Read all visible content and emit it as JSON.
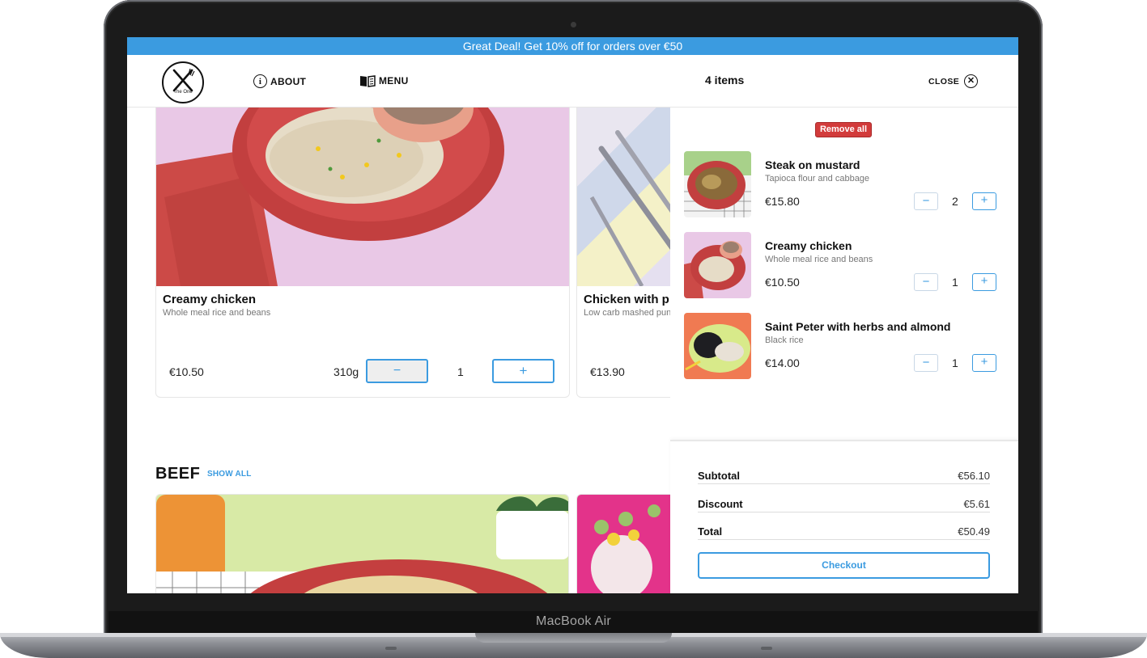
{
  "device": {
    "model_label": "MacBook Air"
  },
  "promo": {
    "text": "Great Deal! Get 10% off for orders over €50"
  },
  "nav": {
    "logo_text": "The One",
    "about_label": "ABOUT",
    "about_icon": "info-icon",
    "menu_label": "MENU",
    "menu_icon": "book-icon",
    "cart_count": "4 items",
    "close_label": "CLOSE",
    "close_icon": "close-circle-icon"
  },
  "main": {
    "cards": [
      {
        "name": "Creamy chicken",
        "desc": "Whole meal rice and beans",
        "price": "€10.50",
        "weight": "310g",
        "qty": "1",
        "minus": "−",
        "plus": "+"
      },
      {
        "name": "Chicken with p",
        "desc": "Low carb mashed pun",
        "price": "€13.90"
      }
    ],
    "section": {
      "title": "BEEF",
      "show_all": "SHOW ALL"
    }
  },
  "cart": {
    "remove_all": "Remove all",
    "items": [
      {
        "name": "Steak on mustard",
        "desc": "Tapioca flour and cabbage",
        "price": "€15.80",
        "qty": "2",
        "minus": "−",
        "plus": "+"
      },
      {
        "name": "Creamy chicken",
        "desc": "Whole meal rice and beans",
        "price": "€10.50",
        "qty": "1",
        "minus": "−",
        "plus": "+"
      },
      {
        "name": "Saint Peter with herbs and almond",
        "desc": "Black rice",
        "price": "€14.00",
        "qty": "1",
        "minus": "−",
        "plus": "+"
      }
    ],
    "summary": {
      "subtotal_label": "Subtotal",
      "subtotal": "€56.10",
      "discount_label": "Discount",
      "discount": "€5.61",
      "total_label": "Total",
      "total": "€50.49"
    },
    "checkout_label": "Checkout"
  },
  "colors": {
    "accent": "#3b9be0",
    "danger": "#d23b3b",
    "promo_bg": "#3b9be0"
  }
}
